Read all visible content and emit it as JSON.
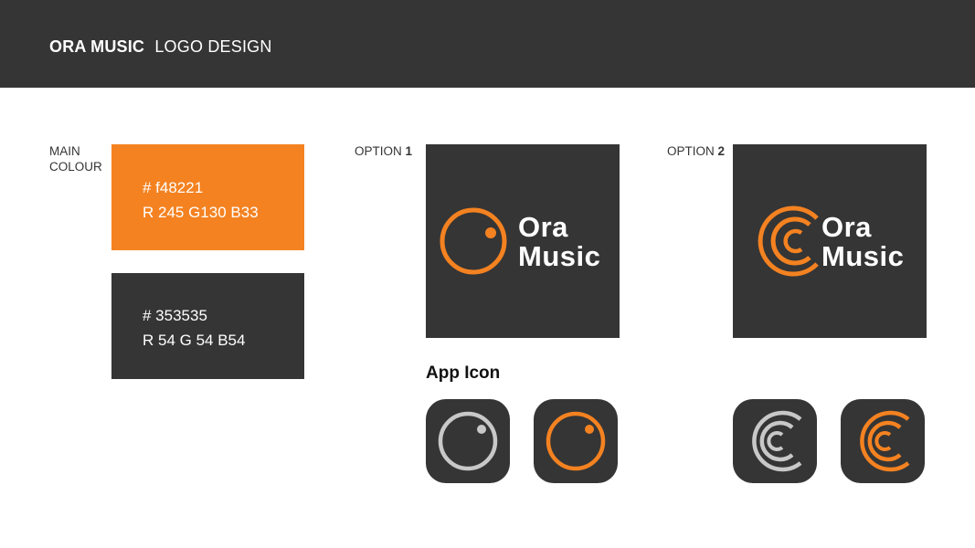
{
  "header": {
    "brand": "ORA MUSIC",
    "subtitle": "LOGO DESIGN"
  },
  "main_colour": {
    "label_line1": "MAIN",
    "label_line2": "COLOUR",
    "swatches": [
      {
        "hex_text": "# f48221",
        "rgb_text": "R 245 G130 B33",
        "color": "#f48221"
      },
      {
        "hex_text": "# 353535",
        "rgb_text": "R 54 G 54 B54",
        "color": "#353535"
      }
    ]
  },
  "options": [
    {
      "label": "OPTION",
      "number": "1",
      "wordmark_line1": "Ora",
      "wordmark_line2": "Music",
      "icon": "dot-circle-icon"
    },
    {
      "label": "OPTION",
      "number": "2",
      "wordmark_line1": "Ora",
      "wordmark_line2": "Music",
      "icon": "nested-c-icon"
    }
  ],
  "app_icon": {
    "title": "App Icon",
    "icons": [
      {
        "name": "dot-circle-icon",
        "color": "#c8c8c8"
      },
      {
        "name": "dot-circle-icon",
        "color": "#f48221"
      },
      {
        "name": "nested-c-icon",
        "color": "#c8c8c8"
      },
      {
        "name": "nested-c-icon",
        "color": "#f48221"
      }
    ]
  },
  "colors": {
    "accent": "#f48221",
    "dark": "#353535",
    "light_grey": "#c8c8c8"
  }
}
